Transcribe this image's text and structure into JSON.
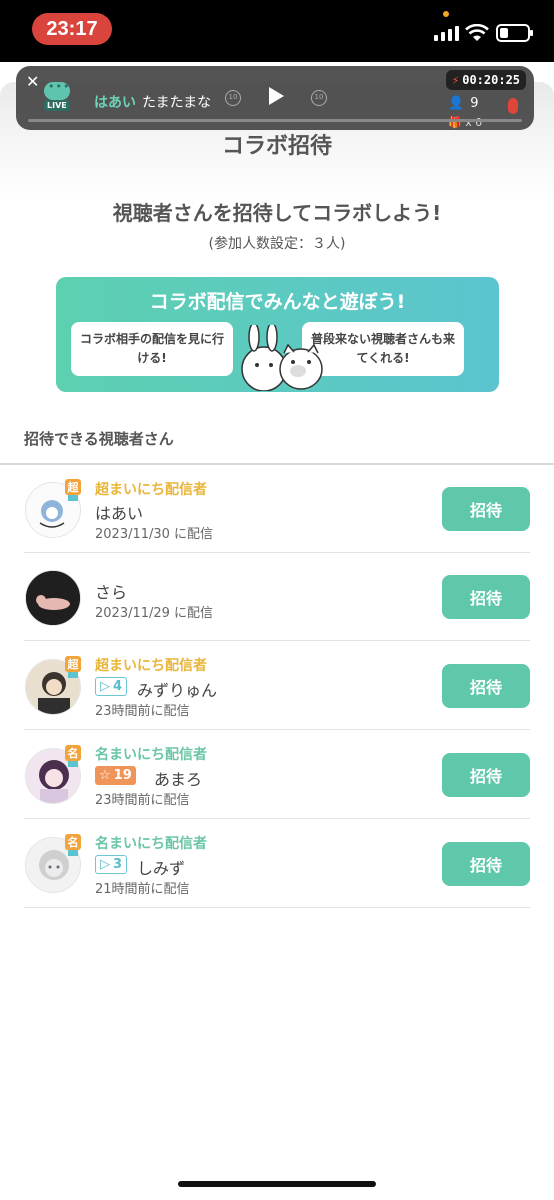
{
  "status_bar": {
    "time": "23:17"
  },
  "mini_player": {
    "host": "はあい",
    "title": "たまたまな",
    "rewind_label": "10",
    "forward_label": "10",
    "timer": "00:20:25",
    "viewers": "9",
    "gifts": "x 0",
    "live_label": "LIVE"
  },
  "page": {
    "title": "コラボ招待"
  },
  "headline": "視聴者さんを招待してコラボしよう!",
  "subline": "(参加人数設定：３人)",
  "banner": {
    "title": "コラボ配信でみんなと遊ぼう!",
    "left_bubble": "コラボ相手の配信を見に行ける!",
    "right_bubble": "普段来ない視聴者さんも来てくれる!"
  },
  "section_title": "招待できる視聴者さん",
  "colors": {
    "accent": "#5fc8ab",
    "gold": "#e9b53b",
    "rank_badge": "#f2a33a"
  },
  "viewers": [
    {
      "badge": "超",
      "rank_label": "超まいにち配信者",
      "name": "はあい",
      "date": "2023/11/30 に配信",
      "button": "招待"
    },
    {
      "name": "さら",
      "date": "2023/11/29 に配信",
      "button": "招待"
    },
    {
      "badge": "超",
      "rank_label": "超まいにち配信者",
      "level": "4",
      "name": "みずりゅん",
      "date": "23時間前に配信",
      "button": "招待"
    },
    {
      "badge": "名",
      "rank_label": "名まいにち配信者",
      "level": "19",
      "name": "あまろ",
      "date": "23時間前に配信",
      "button": "招待"
    },
    {
      "badge": "名",
      "rank_label": "名まいにち配信者",
      "level": "3",
      "name": "しみず",
      "date": "21時間前に配信",
      "button": "招待"
    }
  ]
}
